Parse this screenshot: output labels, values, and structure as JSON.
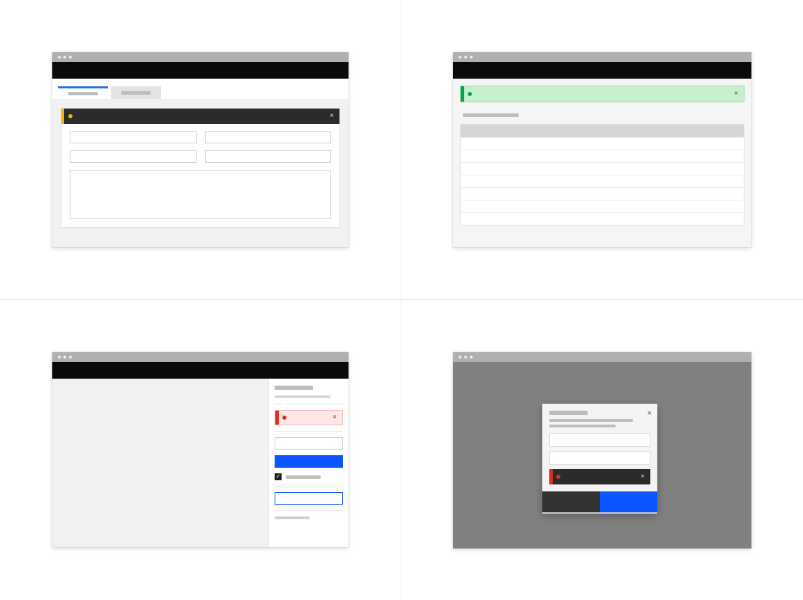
{
  "colors": {
    "warning": "#f4b400",
    "success": "#0f9d58",
    "error": "#d93025",
    "primary": "#0b57ff",
    "dark": "#2b2b2b"
  },
  "q1": {
    "tabs": [
      {
        "label": "",
        "active": true
      },
      {
        "label": "",
        "active": false
      }
    ],
    "warning_banner": {
      "message": "",
      "close": "×"
    },
    "fields": [
      "",
      "",
      "",
      ""
    ],
    "textarea": ""
  },
  "q2": {
    "success_banner": {
      "message": "",
      "close": "×"
    },
    "section_title": "",
    "table": {
      "header": "",
      "rows": [
        "",
        "",
        "",
        "",
        "",
        "",
        ""
      ]
    }
  },
  "q3": {
    "sidebar": {
      "title": "",
      "subtitle": "",
      "error_banner": {
        "message": "",
        "close": "×"
      },
      "input_value": "",
      "primary_button": "",
      "checkbox": {
        "checked": true,
        "label": ""
      },
      "outline_button": "",
      "footer_note": ""
    }
  },
  "q4": {
    "modal": {
      "title": "",
      "body_line1": "",
      "body_line2": "",
      "close": "×",
      "field1": "",
      "field2": "",
      "error_banner": {
        "message": "",
        "close": "×"
      },
      "secondary_action": "",
      "primary_action": ""
    }
  }
}
